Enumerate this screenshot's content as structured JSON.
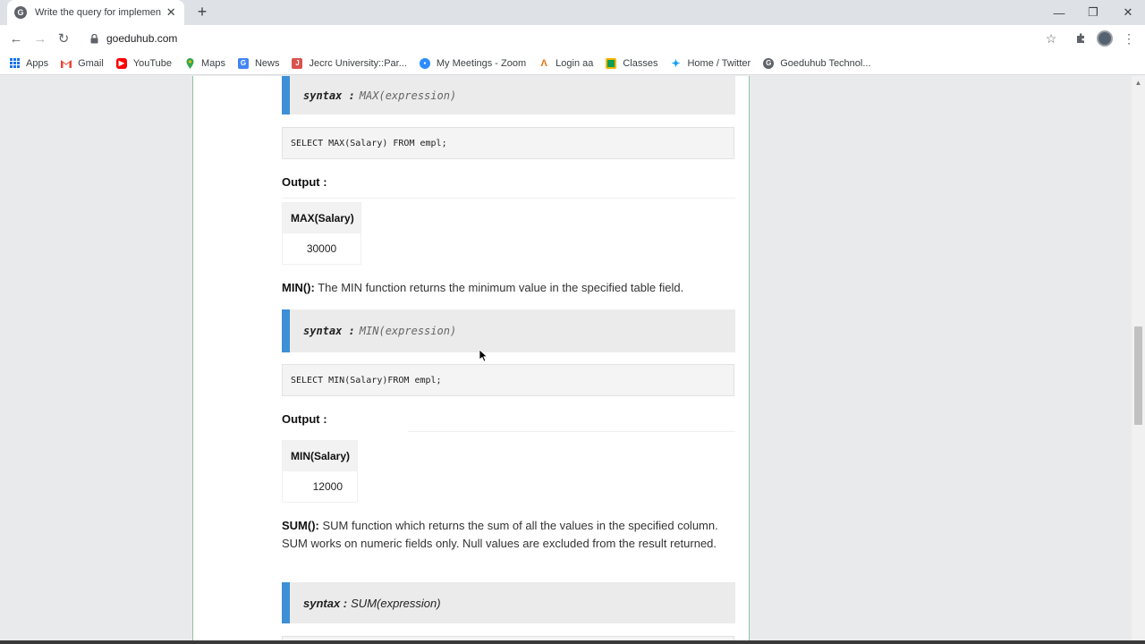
{
  "browser": {
    "tab_title": "Write the query for implementing",
    "tab_favicon": "G",
    "new_tab": "+",
    "url": "goeduhub.com",
    "bookmarks": [
      {
        "label": "Apps",
        "icon": "apps-grid-icon"
      },
      {
        "label": "Gmail",
        "icon": "gmail-icon"
      },
      {
        "label": "YouTube",
        "icon": "youtube-icon"
      },
      {
        "label": "Maps",
        "icon": "maps-icon"
      },
      {
        "label": "News",
        "icon": "news-icon"
      },
      {
        "label": "Jecrc University::Par...",
        "icon": "jecrc-icon"
      },
      {
        "label": "My Meetings - Zoom",
        "icon": "zoom-icon"
      },
      {
        "label": "Login aa",
        "icon": "login-icon"
      },
      {
        "label": "Classes",
        "icon": "classroom-icon"
      },
      {
        "label": "Home / Twitter",
        "icon": "twitter-icon"
      },
      {
        "label": "Goeduhub Technol...",
        "icon": "goeduhub-icon"
      }
    ]
  },
  "article": {
    "max_syntax": {
      "kw": "syntax :",
      "expr": "MAX(expression)"
    },
    "max_query": "SELECT MAX(Salary) FROM empl;",
    "max_output_label": "Output :",
    "max_table": {
      "header": "MAX(Salary)",
      "value": "30000"
    },
    "min_intro": {
      "name": "MIN():",
      "text": " The MIN function returns the minimum value in the specified table field."
    },
    "min_syntax": {
      "kw": "syntax :",
      "expr": "MIN(expression)"
    },
    "min_query": "SELECT MIN(Salary)FROM empl;",
    "min_output_label": "Output :",
    "min_table": {
      "header": "MIN(Salary)",
      "value": "12000"
    },
    "sum_intro": {
      "name": "SUM():",
      "text": " SUM function which returns the sum of all the values in the specified column. SUM works on numeric fields only. Null values are excluded from the result returned."
    },
    "sum_syntax": {
      "kw": "syntax :",
      "expr": "SUM(expression)"
    }
  },
  "colors": {
    "accent_blue": "#3d8fd6",
    "content_border": "#8fc3a5"
  }
}
